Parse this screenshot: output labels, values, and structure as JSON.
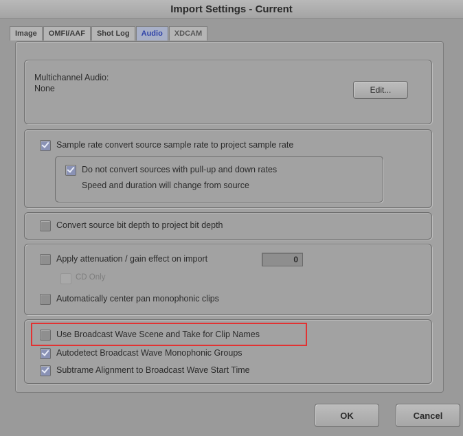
{
  "window": {
    "title": "Import Settings - Current"
  },
  "tabs": [
    {
      "label": "Image",
      "active": false
    },
    {
      "label": "OMFI/AAF",
      "active": false
    },
    {
      "label": "Shot Log",
      "active": false
    },
    {
      "label": "Audio",
      "active": true
    },
    {
      "label": "XDCAM",
      "active": false
    }
  ],
  "multichannel": {
    "label": "Multichannel Audio:",
    "value": "None",
    "edit_button": "Edit..."
  },
  "sample_rate": {
    "convert_label": "Sample rate convert source sample rate to project sample rate",
    "convert_checked": true,
    "pulldown_label": "Do not convert sources with pull-up and down rates",
    "pulldown_checked": true,
    "pulldown_note": "Speed and duration will change from source"
  },
  "bit_depth": {
    "label": "Convert source bit depth to project bit depth",
    "checked": false
  },
  "gain": {
    "attenuation_label": "Apply attenuation / gain effect on import",
    "attenuation_checked": false,
    "attenuation_value": "0",
    "cd_only_label": "CD Only",
    "cd_only_enabled": false,
    "center_pan_label": "Automatically center pan monophonic clips",
    "center_pan_checked": false
  },
  "broadcast_wave": {
    "scene_take_label": "Use Broadcast Wave Scene and Take for Clip Names",
    "scene_take_checked": false,
    "mono_groups_label": "Autodetect Broadcast Wave Monophonic Groups",
    "mono_groups_checked": true,
    "subframe_label": "Subtrame Alignment to Broadcast Wave Start Time",
    "subframe_checked": true
  },
  "footer": {
    "ok_label": "OK",
    "cancel_label": "Cancel"
  },
  "colors": {
    "active_tab_text": "#2f43a8",
    "highlight_border": "#e23232"
  }
}
